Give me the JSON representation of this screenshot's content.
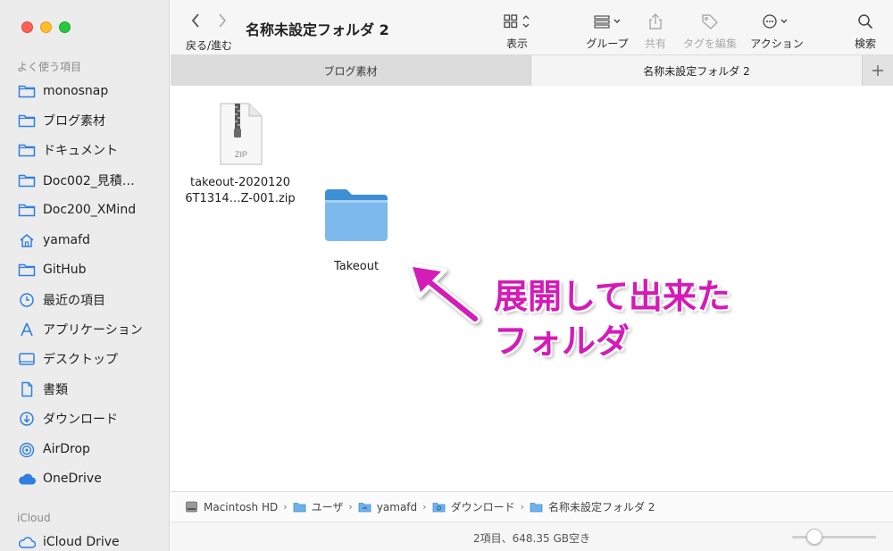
{
  "sidebar": {
    "favorites_header": "よく使う項目",
    "items": [
      {
        "label": "monosnap",
        "icon": "folder-icon"
      },
      {
        "label": "ブログ素材",
        "icon": "folder-icon"
      },
      {
        "label": "ドキュメント",
        "icon": "folder-icon"
      },
      {
        "label": "Doc002_見積…",
        "icon": "folder-icon"
      },
      {
        "label": "Doc200_XMind",
        "icon": "folder-icon"
      },
      {
        "label": "yamafd",
        "icon": "home-icon"
      },
      {
        "label": "GitHub",
        "icon": "folder-icon"
      },
      {
        "label": "最近の項目",
        "icon": "clock-icon"
      },
      {
        "label": "アプリケーション",
        "icon": "applications-icon"
      },
      {
        "label": "デスクトップ",
        "icon": "desktop-icon"
      },
      {
        "label": "書類",
        "icon": "document-icon"
      },
      {
        "label": "ダウンロード",
        "icon": "download-icon"
      },
      {
        "label": "AirDrop",
        "icon": "airdrop-icon"
      },
      {
        "label": "OneDrive",
        "icon": "cloud-icon"
      }
    ],
    "icloud_header": "iCloud",
    "icloud_items": [
      {
        "label": "iCloud Drive",
        "icon": "cloud-icon"
      }
    ]
  },
  "toolbar": {
    "back_forward_label": "戻る/進む",
    "title": "名称未設定フォルダ 2",
    "view_label": "表示",
    "group_label": "グループ",
    "share_label": "共有",
    "tag_label": "タグを編集",
    "action_label": "アクション",
    "search_label": "検索"
  },
  "tabs": [
    {
      "label": "ブログ素材",
      "active": false
    },
    {
      "label": "名称未設定フォルダ 2",
      "active": true
    }
  ],
  "files": [
    {
      "name_line1": "takeout-2020120",
      "name_line2": "6T1314…Z-001.zip",
      "icon": "zip-file-icon",
      "badge": "ZIP"
    },
    {
      "name_line1": "Takeout",
      "icon": "folder-icon"
    }
  ],
  "annotation": {
    "line1": "展開して出来た",
    "line2": "フォルダ",
    "color": "#d41bb7"
  },
  "pathbar": [
    "Macintosh HD",
    "ユーザ",
    "yamafd",
    "ダウンロード",
    "名称未設定フォルダ 2"
  ],
  "status": "2項目、648.35 GB空き",
  "icon_size_slider": 0.2
}
